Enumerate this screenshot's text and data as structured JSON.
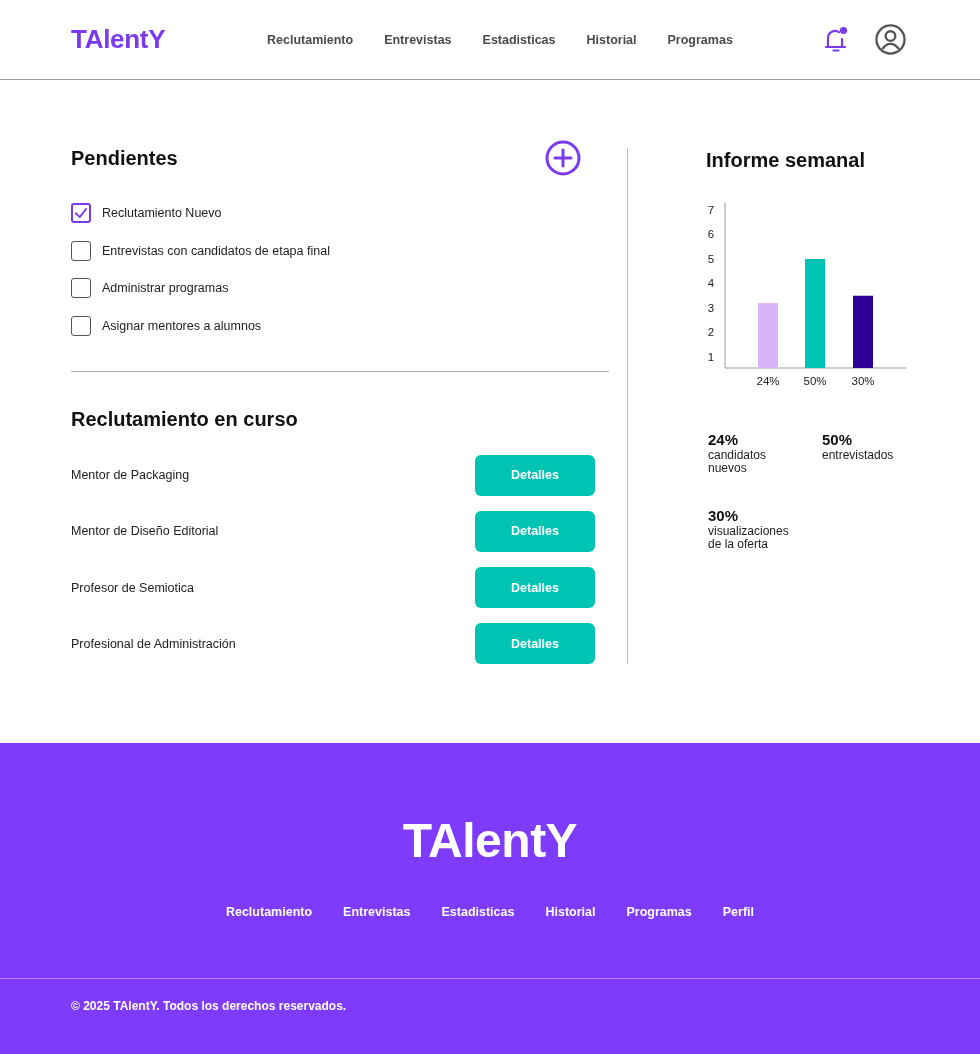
{
  "header": {
    "logo": "TAlentY",
    "nav": [
      "Reclutamiento",
      "Entrevistas",
      "Estadisticas",
      "Historial",
      "Programas"
    ]
  },
  "pendientes": {
    "title": "Pendientes",
    "items": [
      {
        "label": "Reclutamiento Nuevo",
        "checked": true
      },
      {
        "label": "Entrevistas con candidatos de etapa final",
        "checked": false
      },
      {
        "label": "Administrar programas",
        "checked": false
      },
      {
        "label": "Asignar mentores a alumnos",
        "checked": false
      }
    ]
  },
  "reclutamiento": {
    "title": "Reclutamiento en curso",
    "rows": [
      {
        "title": "Mentor de Packaging",
        "button": "Detalles"
      },
      {
        "title": "Mentor de Diseño Editorial",
        "button": "Detalles"
      },
      {
        "title": "Profesor de Semiotica",
        "button": "Detalles"
      },
      {
        "title": "Profesional de Administración",
        "button": "Detalles"
      }
    ]
  },
  "informe": {
    "title": "Informe semanal",
    "chart_data": {
      "type": "bar",
      "categories": [
        "24%",
        "50%",
        "30%"
      ],
      "values": [
        3.2,
        5,
        3.5
      ],
      "colors": [
        "#dab3fb",
        "#00c4b3",
        "#2e0099"
      ],
      "ylim": [
        0.55,
        7.3
      ],
      "yticks": [
        1,
        2,
        3,
        4,
        5,
        6,
        7
      ]
    },
    "stats": [
      {
        "value": "24%",
        "label": "candidatos nuevos"
      },
      {
        "value": "50%",
        "label": "entrevistados"
      },
      {
        "value": "30%",
        "label": "visualizaciones de la oferta"
      }
    ]
  },
  "footer": {
    "logo": "TAlentY",
    "nav": [
      "Reclutamiento",
      "Entrevistas",
      "Estadisticas",
      "Historial",
      "Programas",
      "Perfil"
    ],
    "copyright": "© 2025 TAlentY. Todos los derechos reservados."
  }
}
